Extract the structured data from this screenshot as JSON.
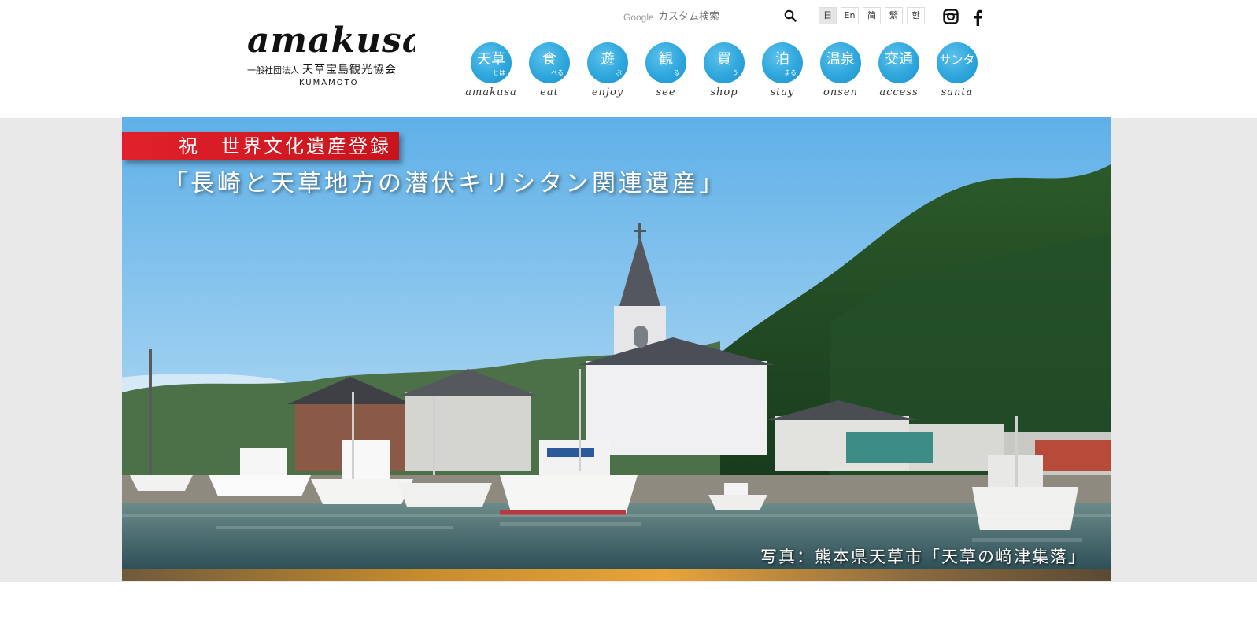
{
  "header": {
    "logo": {
      "script": "amakusa",
      "org_prefix": "一般社団法人",
      "org_name": "天草宝島観光協会",
      "sub": "KUMAMOTO"
    },
    "search": {
      "brand": "Google",
      "placeholder": "カスタム検索",
      "icon": "search-icon"
    },
    "languages": [
      {
        "label": "日",
        "active": true
      },
      {
        "label": "En",
        "active": false
      },
      {
        "label": "简",
        "active": false
      },
      {
        "label": "繁",
        "active": false
      },
      {
        "label": "한",
        "active": false
      }
    ],
    "social": [
      {
        "icon": "instagram-icon"
      },
      {
        "icon": "facebook-icon"
      }
    ],
    "nav": [
      {
        "jp": "天草",
        "kana": "とは",
        "en": "amakusa"
      },
      {
        "jp": "食",
        "kana": "べる",
        "en": "eat"
      },
      {
        "jp": "遊",
        "kana": "ぶ",
        "en": "enjoy"
      },
      {
        "jp": "観",
        "kana": "る",
        "en": "see"
      },
      {
        "jp": "買",
        "kana": "う",
        "en": "shop"
      },
      {
        "jp": "泊",
        "kana": "まる",
        "en": "stay"
      },
      {
        "jp": "温泉",
        "kana": "",
        "en": "onsen"
      },
      {
        "jp": "交通",
        "kana": "",
        "en": "access"
      },
      {
        "jp": "サンタ",
        "kana": "",
        "en": "santa"
      }
    ],
    "nav_color": "#2ea6dc"
  },
  "hero": {
    "ribbon": "祝　世界文化遺産登録",
    "title": "「長崎と天草地方の潜伏キリシタン関連遺産」",
    "caption": "写真：熊本県天草市「天草の﨑津集落」",
    "ribbon_color": "#d91a22"
  }
}
